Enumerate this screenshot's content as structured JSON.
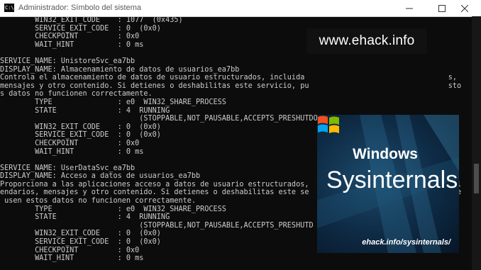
{
  "window": {
    "title": "Administrador: Símbolo del sistema",
    "icon_text": "C:\\",
    "controls": [
      "minimize-icon",
      "maximize-icon",
      "close-icon"
    ]
  },
  "terminal": {
    "lines": [
      "        WIN32_EXIT_CODE    : 1077  (0x435)",
      "        SERVICE_EXIT_CODE  : 0  (0x0)",
      "        CHECKPOINT         : 0x0",
      "        WAIT_HINT          : 0 ms",
      "",
      "SERVICE_NAME: UnistoreSvc_ea7bb",
      "DISPLAY_NAME: Almacenamiento de datos de usuarios_ea7bb",
      "Controla el almacenamiento de datos de usuario estructurados, incluida                                 s,",
      "mensajes y otro contenido. Si detienes o deshabilitas este servicio, pu                                sto",
      "s datos no funcionen correctamente.",
      "        TYPE               : e0  WIN32_SHARE_PROCESS",
      "        STATE              : 4  RUNNING",
      "                                (STOPPABLE,NOT_PAUSABLE,ACCEPTS_PRESHUTDO",
      "        WIN32_EXIT_CODE    : 0  (0x0)",
      "        SERVICE_EXIT_CODE  : 0  (0x0)",
      "        CHECKPOINT         : 0x0",
      "        WAIT_HINT          : 0 ms",
      "",
      "SERVICE_NAME: UserDataSvc_ea7bb",
      "DISPLAY_NAME: Acceso a datos de usuarios_ea7bb",
      "Proporciona a las aplicaciones acceso a datos de usuario estructurados,                                cal",
      "endarios, mensajes y otro contenido. Si detienes o deshabilitas este se                                que",
      " usen estos datos no funcionen correctamente.",
      "        TYPE               : e0  WIN32_SHARE_PROCESS",
      "        STATE              : 4  RUNNING",
      "                                (STOPPABLE,NOT_PAUSABLE,ACCEPTS_PRESHUTD",
      "        WIN32_EXIT_CODE    : 0  (0x0)",
      "        SERVICE_EXIT_CODE  : 0  (0x0)",
      "        CHECKPOINT         : 0x0",
      "        WAIT_HINT          : 0 ms"
    ]
  },
  "watermark": {
    "text": "www.ehack.info"
  },
  "logo": {
    "windows_text": "Windows",
    "sysinternals_text": "Sysinternals",
    "url_text": "ehack.info/sysinternals/",
    "flag_colors": [
      "#f25022",
      "#7fba00",
      "#00a4ef",
      "#ffb900"
    ]
  }
}
